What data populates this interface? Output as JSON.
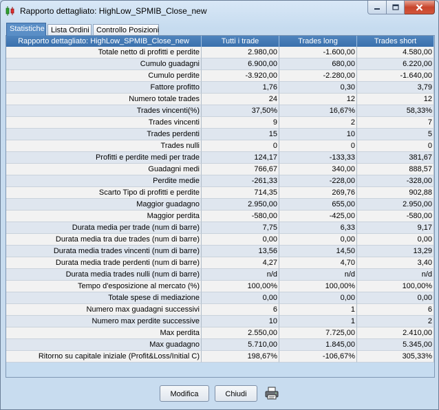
{
  "window": {
    "title": "Rapporto dettagliato: HighLow_SPMIB_Close_new"
  },
  "tabs": [
    "Statistiche",
    "Lista Ordini",
    "Controllo Posizioni"
  ],
  "table": {
    "headers": [
      "Rapporto dettagliato: HighLow_SPMIB_Close_new",
      "Tutti i trade",
      "Trades long",
      "Trades short"
    ],
    "rows": [
      [
        "Totale netto di profitti e perdite",
        "2.980,00",
        "-1.600,00",
        "4.580,00"
      ],
      [
        "Cumulo guadagni",
        "6.900,00",
        "680,00",
        "6.220,00"
      ],
      [
        "Cumulo perdite",
        "-3.920,00",
        "-2.280,00",
        "-1.640,00"
      ],
      [
        "Fattore profitto",
        "1,76",
        "0,30",
        "3,79"
      ],
      [
        "Numero totale trades",
        "24",
        "12",
        "12"
      ],
      [
        "Trades vincenti(%)",
        "37,50%",
        "16,67%",
        "58,33%"
      ],
      [
        "Trades vincenti",
        "9",
        "2",
        "7"
      ],
      [
        "Trades perdenti",
        "15",
        "10",
        "5"
      ],
      [
        "Trades nulli",
        "0",
        "0",
        "0"
      ],
      [
        "Profitti e perdite medi per trade",
        "124,17",
        "-133,33",
        "381,67"
      ],
      [
        "Guadagni medi",
        "766,67",
        "340,00",
        "888,57"
      ],
      [
        "Perdite medie",
        "-261,33",
        "-228,00",
        "-328,00"
      ],
      [
        "Scarto Tipo di profitti e perdite",
        "714,35",
        "269,76",
        "902,88"
      ],
      [
        "Maggior guadagno",
        "2.950,00",
        "655,00",
        "2.950,00"
      ],
      [
        "Maggior perdita",
        "-580,00",
        "-425,00",
        "-580,00"
      ],
      [
        "Durata media per trade (num di barre)",
        "7,75",
        "6,33",
        "9,17"
      ],
      [
        "Durata media tra due trades (num di barre)",
        "0,00",
        "0,00",
        "0,00"
      ],
      [
        "Durata media trades vincenti (num di barre)",
        "13,56",
        "14,50",
        "13,29"
      ],
      [
        "Durata media trade perdenti (num di barre)",
        "4,27",
        "4,70",
        "3,40"
      ],
      [
        "Durata media trades nulli (num di barre)",
        "n/d",
        "n/d",
        "n/d"
      ],
      [
        "Tempo d'esposizione al mercato (%)",
        "100,00%",
        "100,00%",
        "100,00%"
      ],
      [
        "Totale spese di mediazione",
        "0,00",
        "0,00",
        "0,00"
      ],
      [
        "Numero max guadagni successivi",
        "6",
        "1",
        "6"
      ],
      [
        "Numero max perdite successive",
        "10",
        "1",
        "2"
      ],
      [
        "Max perdita",
        "2.550,00",
        "7.725,00",
        "2.410,00"
      ],
      [
        "Max guadagno",
        "5.710,00",
        "1.845,00",
        "5.345,00"
      ],
      [
        "Ritorno su capitale iniziale (Profit&Loss/Initial C)",
        "198,67%",
        "-106,67%",
        "305,33%"
      ]
    ]
  },
  "buttons": {
    "modify": "Modifica",
    "close": "Chiudi"
  },
  "icons": {
    "app": "candlestick-chart-icon",
    "print": "printer-icon"
  },
  "colors": {
    "tab_active": "#5a8ec6",
    "header_bg": "#3f76b3",
    "close_button": "#c8452c"
  }
}
